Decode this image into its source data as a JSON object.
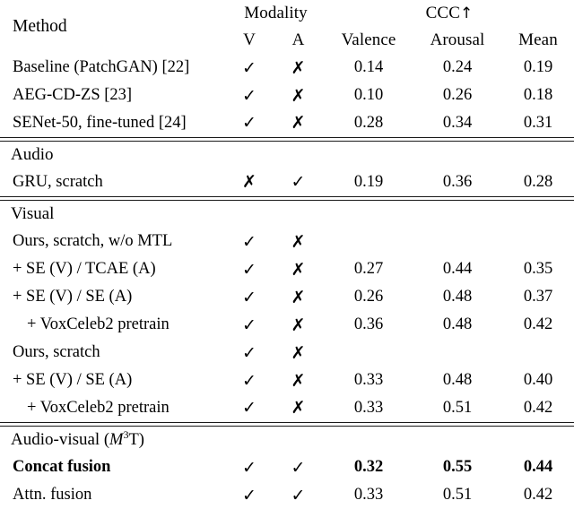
{
  "table": {
    "header": {
      "method_label": "Method",
      "modality_label": "Modality",
      "ccc_label": "CCC",
      "ccc_arrow": "↑",
      "sub_v": "V",
      "sub_a": "A",
      "sub_valence": "Valence",
      "sub_arousal": "Arousal",
      "sub_mean": "Mean"
    },
    "marks": {
      "check": "✓",
      "cross": "✗"
    },
    "sections": [
      {
        "id": "baselines",
        "heading": null,
        "rows": [
          {
            "method": "Baseline (PatchGAN) [22]",
            "v": "✓",
            "a": "✗",
            "valence": "0.14",
            "arousal": "0.24",
            "mean": "0.19",
            "indent": false,
            "bold": false,
            "rule_below": "thin"
          },
          {
            "method": "AEG-CD-ZS [23]",
            "v": "✓",
            "a": "✗",
            "valence": "0.10",
            "arousal": "0.26",
            "mean": "0.18",
            "indent": false,
            "bold": false,
            "rule_below": "thin"
          },
          {
            "method": "SENet-50, fine-tuned [24]",
            "v": "✓",
            "a": "✗",
            "valence": "0.28",
            "arousal": "0.34",
            "mean": "0.31",
            "indent": false,
            "bold": false,
            "rule_below": "thin"
          }
        ]
      },
      {
        "id": "audio",
        "heading": {
          "text": "Audio",
          "math": null
        },
        "rows": [
          {
            "method": "GRU, scratch",
            "v": "✗",
            "a": "✓",
            "valence": "0.19",
            "arousal": "0.36",
            "mean": "0.28",
            "indent": false,
            "bold": false,
            "rule_below": "none"
          }
        ]
      },
      {
        "id": "visual",
        "heading": {
          "text": "Visual",
          "math": null
        },
        "rows": [
          {
            "method": "Ours, scratch, w/o MTL",
            "v": "✓",
            "a": "✗",
            "valence": "",
            "arousal": "",
            "mean": "",
            "indent": false,
            "bold": false,
            "rule_below": "none"
          },
          {
            "method": "+ SE (V) / TCAE (A)",
            "v": "✓",
            "a": "✗",
            "valence": "0.27",
            "arousal": "0.44",
            "mean": "0.35",
            "indent": false,
            "bold": false,
            "rule_below": "none"
          },
          {
            "method": "+ SE (V) / SE (A)",
            "v": "✓",
            "a": "✗",
            "valence": "0.26",
            "arousal": "0.48",
            "mean": "0.37",
            "indent": false,
            "bold": false,
            "rule_below": "none"
          },
          {
            "method": "+ VoxCeleb2 pretrain",
            "v": "✓",
            "a": "✗",
            "valence": "0.36",
            "arousal": "0.48",
            "mean": "0.42",
            "indent": true,
            "bold": false,
            "rule_below": "thin"
          },
          {
            "method": "Ours, scratch",
            "v": "✓",
            "a": "✗",
            "valence": "",
            "arousal": "",
            "mean": "",
            "indent": false,
            "bold": false,
            "rule_below": "none"
          },
          {
            "method": "+ SE (V) / SE (A)",
            "v": "✓",
            "a": "✗",
            "valence": "0.33",
            "arousal": "0.48",
            "mean": "0.40",
            "indent": false,
            "bold": false,
            "rule_below": "none"
          },
          {
            "method": "+ VoxCeleb2 pretrain",
            "v": "✓",
            "a": "✗",
            "valence": "0.33",
            "arousal": "0.51",
            "mean": "0.42",
            "indent": true,
            "bold": false,
            "rule_below": "none"
          }
        ]
      },
      {
        "id": "audio-visual",
        "heading": {
          "text": "Audio-visual",
          "math": "(M3T)"
        },
        "rows": [
          {
            "method": "Concat fusion",
            "v": "✓",
            "a": "✓",
            "valence": "0.32",
            "arousal": "0.55",
            "mean": "0.44",
            "indent": false,
            "bold": true,
            "rule_below": "thin"
          },
          {
            "method": "Attn. fusion",
            "v": "✓",
            "a": "✓",
            "valence": "0.33",
            "arousal": "0.51",
            "mean": "0.42",
            "indent": false,
            "bold": false,
            "rule_below": "none"
          }
        ]
      }
    ]
  },
  "colors": {
    "rule": "#1a1a1a",
    "text": "#000000",
    "background": "#ffffff"
  }
}
